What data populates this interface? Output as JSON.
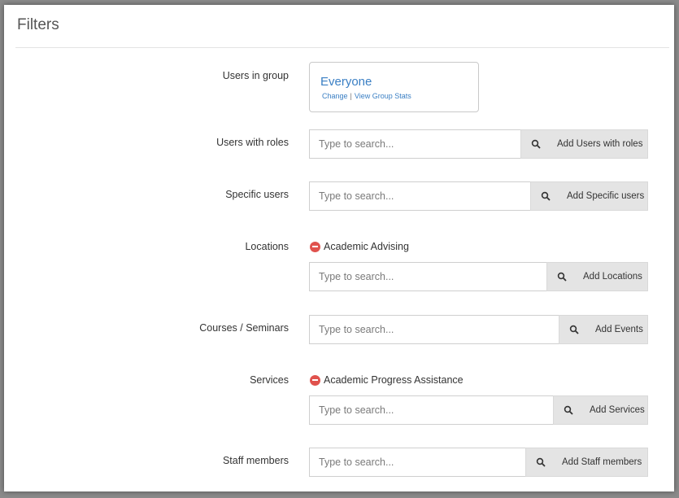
{
  "panel": {
    "title": "Filters"
  },
  "group": {
    "label": "Users in group",
    "value": "Everyone",
    "change_link": "Change",
    "separator": "|",
    "stats_link": "View Group Stats"
  },
  "search_placeholder": "Type to search...",
  "roles": {
    "label": "Users with roles",
    "button": "Add Users with roles"
  },
  "specific_users": {
    "label": "Specific users",
    "button": "Add Specific users"
  },
  "locations": {
    "label": "Locations",
    "selected": "Academic Advising",
    "button": "Add Locations"
  },
  "courses": {
    "label": "Courses / Seminars",
    "button": "Add Events"
  },
  "services": {
    "label": "Services",
    "selected": "Academic Progress Assistance",
    "button": "Add Services"
  },
  "staff": {
    "label": "Staff members",
    "button": "Add Staff members"
  },
  "colors": {
    "link": "#3a7fc4",
    "remove": "#e0524d",
    "button_bg": "#e4e4e4"
  },
  "icons": {
    "search": "search-icon",
    "remove": "minus-circle-icon"
  }
}
